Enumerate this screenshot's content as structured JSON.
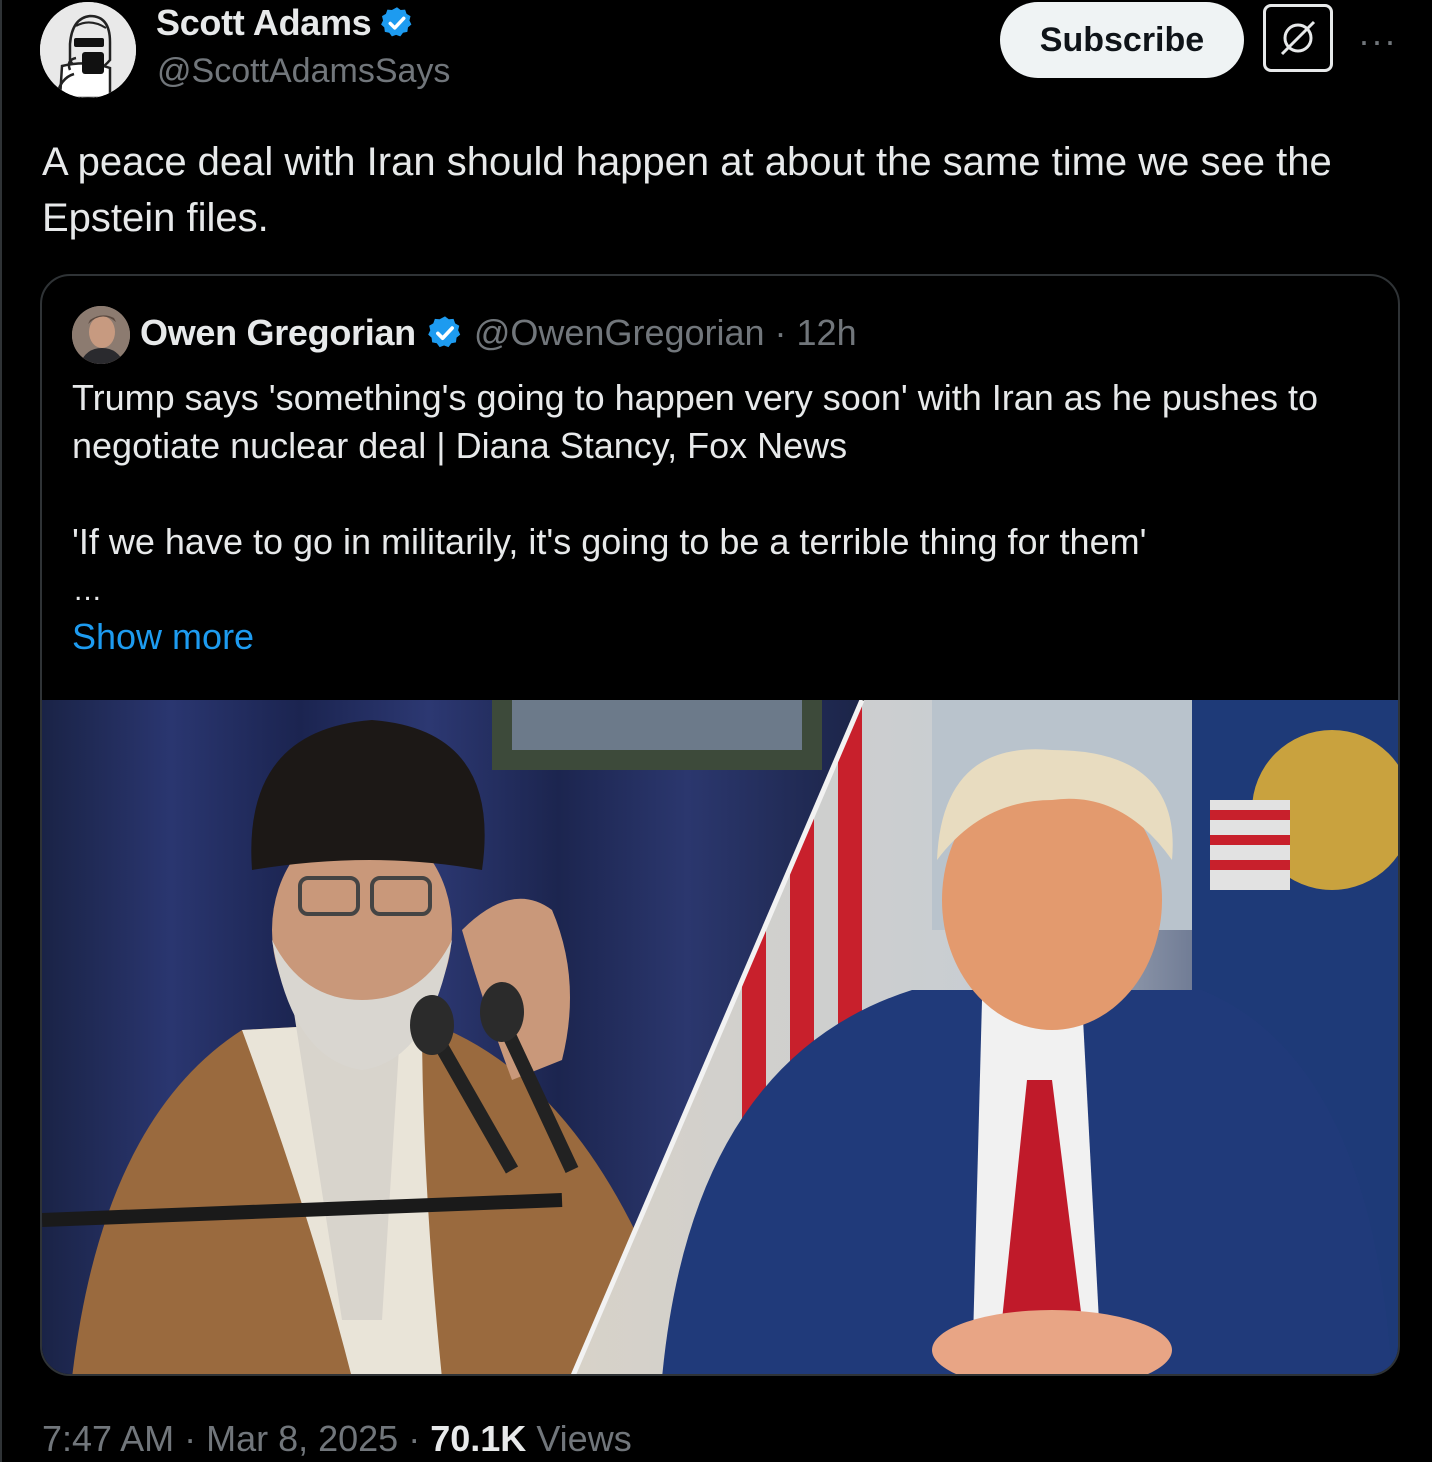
{
  "author": {
    "display_name": "Scott Adams",
    "handle": "@ScottAdamsSays",
    "verified_icon": "verified-badge-icon",
    "avatar_icon": "avatar-illustration"
  },
  "actions": {
    "subscribe_label": "Subscribe",
    "grok_icon": "grok-icon",
    "more_label": "···"
  },
  "post": {
    "text": "A peace deal with Iran should happen at about the same time we see the Epstein files."
  },
  "quote": {
    "display_name": "Owen Gregorian",
    "handle": "@OwenGregorian",
    "separator": "·",
    "time": "12h",
    "paragraph_1": "Trump says 'something's going to happen very soon' with Iran as he pushes to negotiate nuclear deal | Diana Stancy, Fox News",
    "paragraph_2": "'If we have to go in militarily, it's going to be a terrible thing for them'",
    "ellipsis": "...",
    "show_more": "Show more",
    "media_icon": "split-photo"
  },
  "meta": {
    "time": "7:47 AM",
    "sep1": "·",
    "date": "Mar 8, 2025",
    "sep2": "·",
    "views_count": "70.1K",
    "views_label": "Views"
  },
  "colors": {
    "background": "#000000",
    "text": "#e7e9ea",
    "muted": "#71767b",
    "link": "#1d9bf0",
    "verified": "#1d9bf0",
    "border": "#2f3336"
  }
}
